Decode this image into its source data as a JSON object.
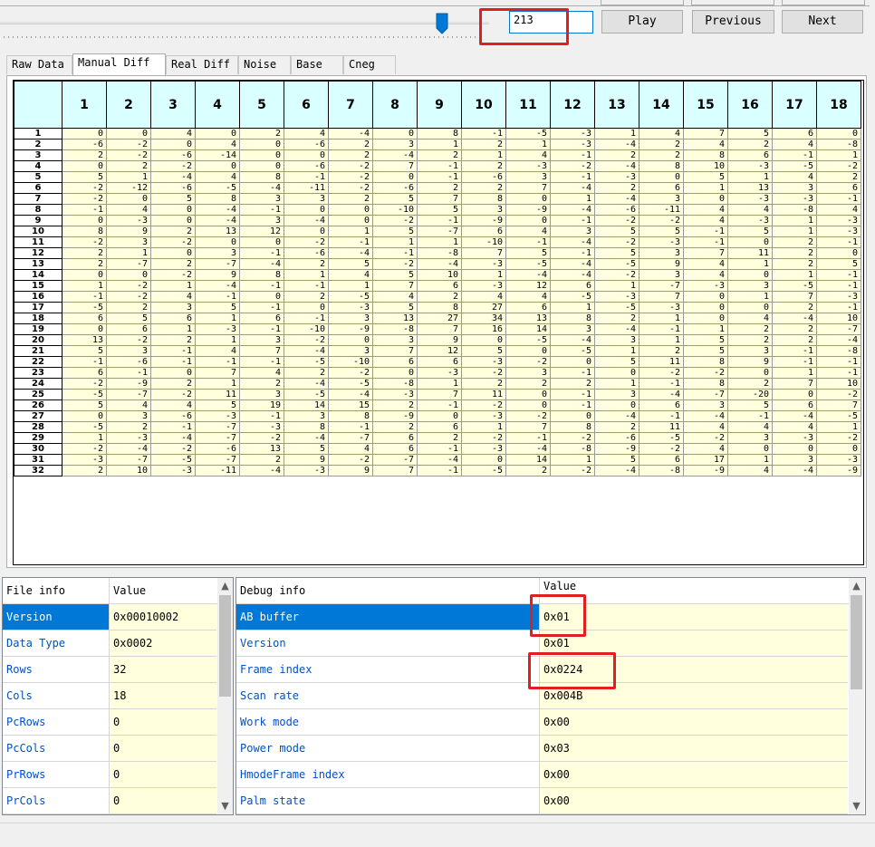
{
  "toolbar": {
    "frame_value": "213",
    "play_label": "Play",
    "previous_label": "Previous",
    "next_label": "Next"
  },
  "tabs": [
    "Raw Data",
    "Manual Diff",
    "Real Diff",
    "Noise",
    "Base",
    "Cneg"
  ],
  "active_tab": 1,
  "grid": {
    "columns": [
      "1",
      "2",
      "3",
      "4",
      "5",
      "6",
      "7",
      "8",
      "9",
      "10",
      "11",
      "12",
      "13",
      "14",
      "15",
      "16",
      "17",
      "18"
    ],
    "rows": [
      {
        "label": "1",
        "values": [
          0,
          0,
          4,
          0,
          2,
          4,
          -4,
          0,
          8,
          -1,
          -5,
          -3,
          1,
          4,
          7,
          5,
          6,
          0
        ]
      },
      {
        "label": "2",
        "values": [
          -6,
          -2,
          0,
          4,
          0,
          -6,
          2,
          3,
          1,
          2,
          1,
          -3,
          -4,
          2,
          4,
          2,
          4,
          -8
        ]
      },
      {
        "label": "3",
        "values": [
          2,
          -2,
          -6,
          -14,
          0,
          0,
          2,
          -4,
          2,
          1,
          4,
          -1,
          2,
          2,
          8,
          6,
          -1,
          1
        ]
      },
      {
        "label": "4",
        "values": [
          0,
          2,
          -2,
          0,
          0,
          -6,
          -2,
          7,
          -1,
          2,
          -3,
          -2,
          -4,
          8,
          10,
          -3,
          -5,
          -2
        ]
      },
      {
        "label": "5",
        "values": [
          5,
          1,
          -4,
          4,
          8,
          -1,
          -2,
          0,
          -1,
          -6,
          3,
          -1,
          -3,
          0,
          5,
          1,
          4,
          2
        ]
      },
      {
        "label": "6",
        "values": [
          -2,
          -12,
          -6,
          -5,
          -4,
          -11,
          -2,
          -6,
          2,
          2,
          7,
          -4,
          2,
          6,
          1,
          13,
          3,
          6
        ]
      },
      {
        "label": "7",
        "values": [
          -2,
          0,
          5,
          8,
          3,
          3,
          2,
          5,
          7,
          8,
          0,
          1,
          -4,
          3,
          0,
          -3,
          -3,
          -1
        ]
      },
      {
        "label": "8",
        "values": [
          -1,
          4,
          0,
          -4,
          -1,
          0,
          0,
          -10,
          5,
          3,
          -9,
          -4,
          -6,
          -11,
          4,
          4,
          -8,
          4
        ]
      },
      {
        "label": "9",
        "values": [
          0,
          -3,
          0,
          -4,
          3,
          -4,
          0,
          -2,
          -1,
          -9,
          0,
          -1,
          -2,
          -2,
          4,
          -3,
          1,
          -3
        ]
      },
      {
        "label": "10",
        "values": [
          8,
          9,
          2,
          13,
          12,
          0,
          1,
          5,
          -7,
          6,
          4,
          3,
          5,
          5,
          -1,
          5,
          1,
          -3
        ]
      },
      {
        "label": "11",
        "values": [
          -2,
          3,
          -2,
          0,
          0,
          -2,
          -1,
          1,
          1,
          -10,
          -1,
          -4,
          -2,
          -3,
          -1,
          0,
          2,
          -1
        ]
      },
      {
        "label": "12",
        "values": [
          2,
          1,
          0,
          3,
          -1,
          -6,
          -4,
          -1,
          -8,
          7,
          5,
          -1,
          5,
          3,
          7,
          11,
          2,
          0
        ]
      },
      {
        "label": "13",
        "values": [
          2,
          -7,
          2,
          -7,
          -4,
          2,
          5,
          -2,
          -4,
          -3,
          -5,
          -4,
          -5,
          9,
          4,
          1,
          2,
          5
        ]
      },
      {
        "label": "14",
        "values": [
          0,
          0,
          -2,
          9,
          8,
          1,
          4,
          5,
          10,
          1,
          -4,
          -4,
          -2,
          3,
          4,
          0,
          1,
          -1
        ]
      },
      {
        "label": "15",
        "values": [
          1,
          -2,
          1,
          -4,
          -1,
          -1,
          1,
          7,
          6,
          -3,
          12,
          6,
          1,
          -7,
          -3,
          3,
          -5,
          -1
        ]
      },
      {
        "label": "16",
        "values": [
          -1,
          -2,
          4,
          -1,
          0,
          2,
          -5,
          4,
          2,
          4,
          4,
          -5,
          -3,
          7,
          0,
          1,
          7,
          -3
        ]
      },
      {
        "label": "17",
        "values": [
          -5,
          2,
          3,
          5,
          -1,
          0,
          -3,
          5,
          8,
          27,
          6,
          1,
          -5,
          -3,
          0,
          0,
          2,
          -1
        ]
      },
      {
        "label": "18",
        "values": [
          6,
          5,
          6,
          1,
          6,
          -1,
          3,
          13,
          27,
          34,
          13,
          8,
          2,
          1,
          0,
          4,
          -4,
          10
        ]
      },
      {
        "label": "19",
        "values": [
          0,
          6,
          1,
          -3,
          -1,
          -10,
          -9,
          -8,
          7,
          16,
          14,
          3,
          -4,
          -1,
          1,
          2,
          2,
          -7
        ]
      },
      {
        "label": "20",
        "values": [
          13,
          -2,
          2,
          1,
          3,
          -2,
          0,
          3,
          9,
          0,
          -5,
          -4,
          3,
          1,
          5,
          2,
          2,
          -4
        ]
      },
      {
        "label": "21",
        "values": [
          5,
          3,
          -1,
          4,
          7,
          -4,
          3,
          7,
          12,
          5,
          0,
          -5,
          1,
          2,
          5,
          3,
          -1,
          -8
        ]
      },
      {
        "label": "22",
        "values": [
          -1,
          -6,
          -1,
          -1,
          -1,
          -5,
          -10,
          6,
          6,
          -3,
          -2,
          0,
          5,
          11,
          8,
          9,
          -1,
          -1
        ]
      },
      {
        "label": "23",
        "values": [
          6,
          -1,
          0,
          7,
          4,
          2,
          -2,
          0,
          -3,
          -2,
          3,
          -1,
          0,
          -2,
          -2,
          0,
          1,
          -1
        ]
      },
      {
        "label": "24",
        "values": [
          -2,
          -9,
          2,
          1,
          2,
          -4,
          -5,
          -8,
          1,
          2,
          2,
          2,
          1,
          -1,
          8,
          2,
          7,
          10
        ]
      },
      {
        "label": "25",
        "values": [
          -5,
          -7,
          -2,
          11,
          3,
          -5,
          -4,
          -3,
          7,
          11,
          0,
          -1,
          3,
          -4,
          -7,
          -20,
          0,
          -2
        ]
      },
      {
        "label": "26",
        "values": [
          5,
          4,
          4,
          5,
          19,
          14,
          15,
          2,
          -1,
          -2,
          0,
          -1,
          0,
          6,
          3,
          5,
          6,
          7
        ]
      },
      {
        "label": "27",
        "values": [
          0,
          3,
          -6,
          -3,
          -1,
          3,
          8,
          -9,
          0,
          -3,
          -2,
          0,
          -4,
          -1,
          -4,
          -1,
          -4,
          -5
        ]
      },
      {
        "label": "28",
        "values": [
          -5,
          2,
          -1,
          -7,
          -3,
          8,
          -1,
          2,
          6,
          1,
          7,
          8,
          2,
          11,
          4,
          4,
          4,
          1
        ]
      },
      {
        "label": "29",
        "values": [
          1,
          -3,
          -4,
          -7,
          -2,
          -4,
          -7,
          6,
          2,
          -2,
          -1,
          -2,
          -6,
          -5,
          -2,
          3,
          -3,
          -2
        ]
      },
      {
        "label": "30",
        "values": [
          -2,
          -4,
          -2,
          -6,
          13,
          5,
          4,
          6,
          -1,
          -3,
          -4,
          -8,
          -9,
          -2,
          4,
          0,
          0,
          0
        ]
      },
      {
        "label": "31",
        "values": [
          -3,
          -7,
          -5,
          -7,
          2,
          9,
          -2,
          -7,
          -4,
          0,
          14,
          1,
          5,
          6,
          17,
          1,
          3,
          -3
        ]
      },
      {
        "label": "32",
        "values": [
          2,
          10,
          -3,
          -11,
          -4,
          -3,
          9,
          7,
          -1,
          -5,
          2,
          -2,
          -4,
          -8,
          -9,
          4,
          -4,
          -9
        ]
      }
    ]
  },
  "file_info": {
    "header_name": "File info",
    "header_value": "Value",
    "rows": [
      {
        "name": "Version",
        "value": "0x00010002"
      },
      {
        "name": "Data Type",
        "value": "0x0002"
      },
      {
        "name": "Rows",
        "value": "32"
      },
      {
        "name": "Cols",
        "value": "18"
      },
      {
        "name": "PcRows",
        "value": "0"
      },
      {
        "name": "PcCols",
        "value": "0"
      },
      {
        "name": "PrRows",
        "value": "0"
      },
      {
        "name": "PrCols",
        "value": "0"
      }
    ]
  },
  "debug_info": {
    "header_name": "Debug info",
    "header_value": "Value",
    "rows": [
      {
        "name": "AB buffer",
        "value": "0x01"
      },
      {
        "name": "Version",
        "value": "0x01"
      },
      {
        "name": "Frame index",
        "value": "0x0224"
      },
      {
        "name": "Scan rate",
        "value": "0x004B"
      },
      {
        "name": "Work mode",
        "value": "0x00"
      },
      {
        "name": "Power mode",
        "value": "0x03"
      },
      {
        "name": "HmodeFrame index",
        "value": "0x00"
      },
      {
        "name": "Palm state",
        "value": "0x00"
      }
    ]
  },
  "colors": {
    "highlight": "#e02020",
    "selection": "#0078d7",
    "cell_bg": "#ffffdd",
    "header_bg": "#d9ffff"
  }
}
